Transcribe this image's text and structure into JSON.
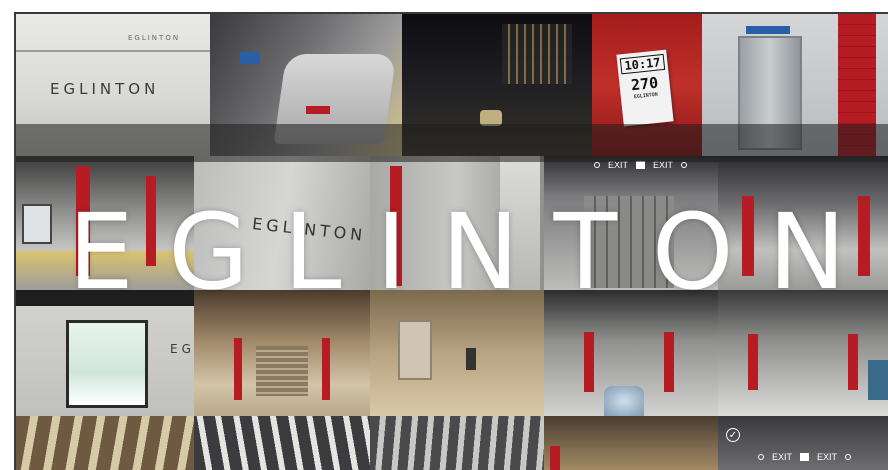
{
  "title": {
    "letters": [
      "E",
      "G",
      "L",
      "I",
      "N",
      "T",
      "O",
      "N"
    ]
  },
  "tiles": {
    "wall_sign_main": "EGLINTON",
    "wall_sign_small": "EGLINTON",
    "wall_partial_1": "EGLINTON",
    "wall_partial_2": "EG",
    "ticket": {
      "time": "10:17",
      "route": "270",
      "line1": "EGLINTON"
    },
    "exit_sign_top": {
      "left": "EXIT",
      "right": "EXIT"
    },
    "exit_sign_bottom": {
      "left": "EXIT",
      "right": "EXIT"
    }
  },
  "colors": {
    "station_red": "#b51c24",
    "wall_grey": "#c9c9c7",
    "title_white": "#ffffff"
  }
}
